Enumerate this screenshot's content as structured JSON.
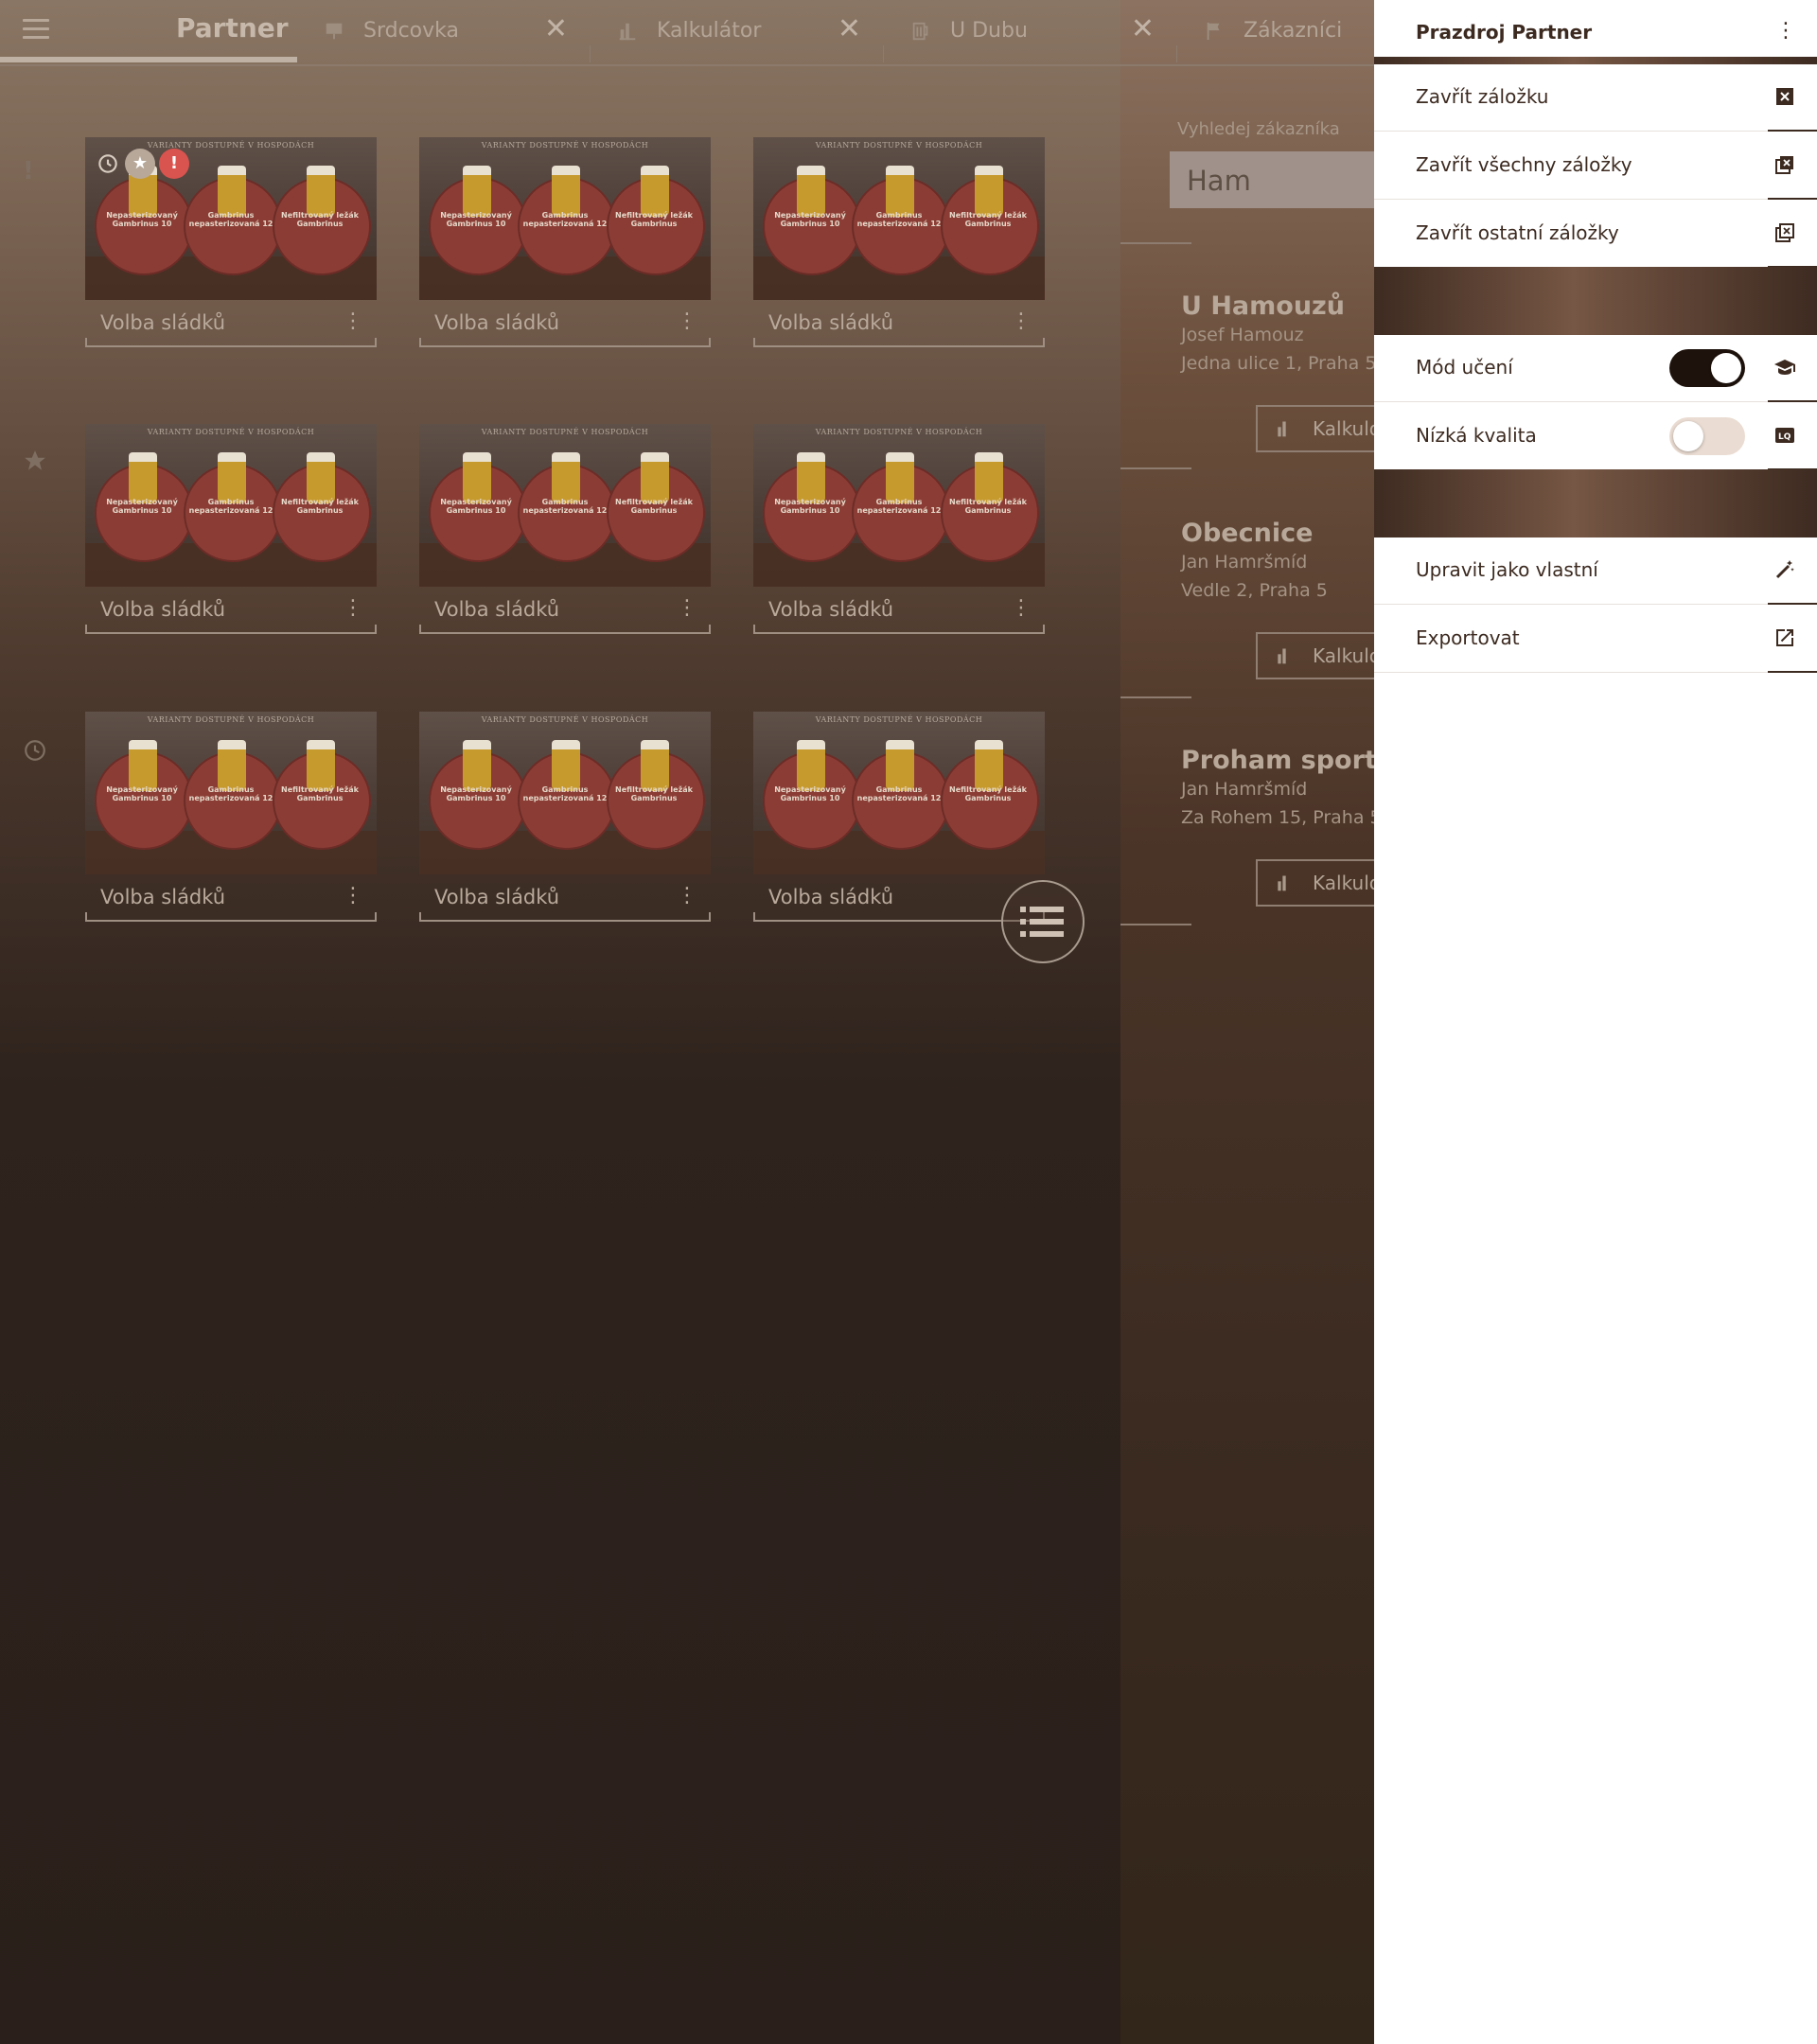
{
  "topbar": {
    "brand": "Partner",
    "tabs": [
      {
        "label": "Srdcovka",
        "icon": "presentation-icon"
      },
      {
        "label": "Kalkulátor",
        "icon": "bar-chart-icon"
      },
      {
        "label": "U Dubu",
        "icon": "beer-mug-icon"
      },
      {
        "label": "Zákazníci",
        "icon": "flag-icon"
      }
    ]
  },
  "sidebar": {
    "icons": [
      "exclamation-icon",
      "star-icon",
      "history-icon"
    ],
    "exclamation_glyph": "!"
  },
  "cards": {
    "title": "Volba sládků",
    "thumbnail": {
      "caption": "VARIANTY DOSTUPNÉ V HOSPODÁCH",
      "plates": [
        "Nepasterizovaný Gambrinus 10",
        "Gambrinus nepasterizovaná 12",
        "Nefiltrovaný ležák Gambrinus"
      ]
    },
    "count": 9
  },
  "search": {
    "label": "Vyhledej zákazníka",
    "value": "Ham"
  },
  "customers": [
    {
      "name": "U Hamouzů",
      "person": "Josef Hamouz",
      "address": "Jedna ulice 1, Praha 5",
      "button": "Kalkulo"
    },
    {
      "name": "Obecnice",
      "person": "Jan Hamršmíd",
      "address": "Vedle 2, Praha 5",
      "button": "Kalkulo"
    },
    {
      "name": "Proham sportba",
      "person": "Jan Hamršmíd",
      "address": "Za Rohem 15, Praha 5",
      "button": "Kalkulo"
    }
  ],
  "drawer": {
    "title": "Prazdroj Partner",
    "group1": [
      {
        "label": "Zavřít záložku",
        "icon": "close-box-icon"
      },
      {
        "label": "Zavřít všechny záložky",
        "icon": "close-all-icon"
      },
      {
        "label": "Zavřít ostatní záložky",
        "icon": "close-others-icon"
      }
    ],
    "group2": [
      {
        "label": "Mód učení",
        "icon": "graduation-cap-icon",
        "on": true
      },
      {
        "label": "Nízká kvalita",
        "icon": "low-quality-icon",
        "on": false
      }
    ],
    "group3": [
      {
        "label": "Upravit jako vlastní",
        "icon": "magic-wand-icon"
      },
      {
        "label": "Exportovat",
        "icon": "open-external-icon"
      }
    ]
  },
  "colors": {
    "brand_dark": "#3c2a20",
    "toggle_on": "#1e120c",
    "toggle_off": "#eadcd2",
    "alert": "#d9534f"
  }
}
